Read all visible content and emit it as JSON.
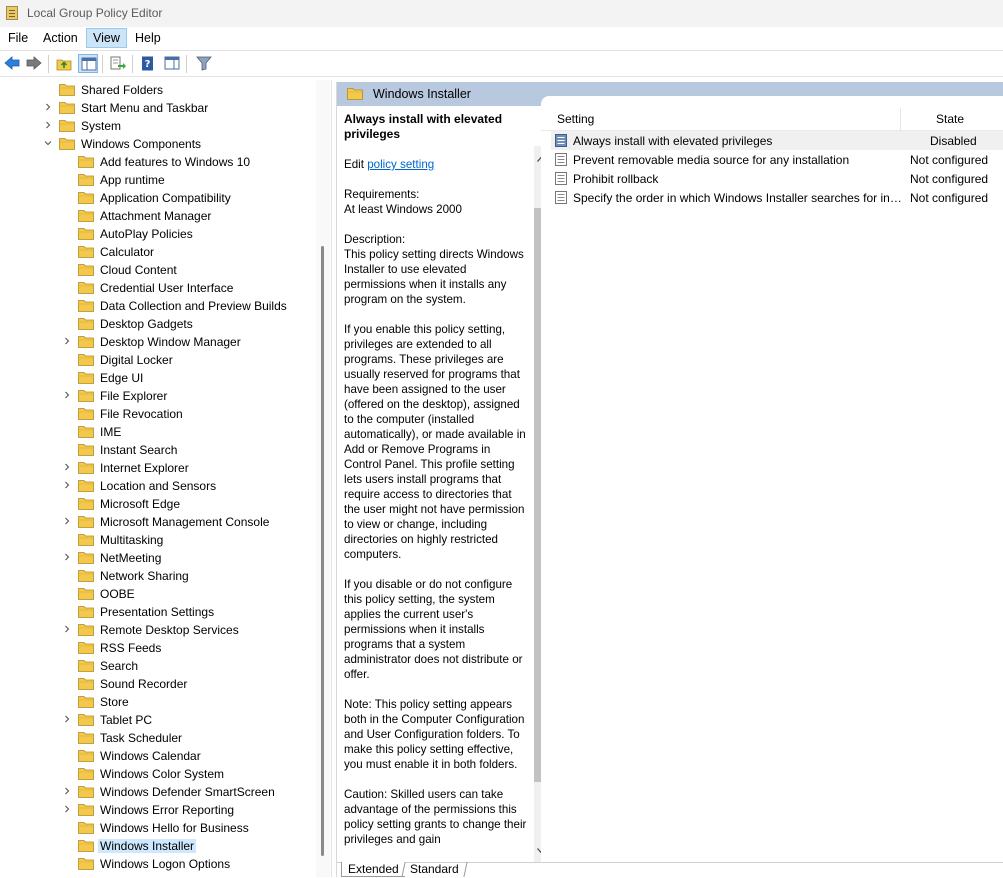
{
  "window": {
    "title": "Local Group Policy Editor"
  },
  "menu": [
    "File",
    "Action",
    "View",
    "Help"
  ],
  "tree": [
    {
      "label": "Shared Folders",
      "level": 1,
      "expand": "none"
    },
    {
      "label": "Start Menu and Taskbar",
      "level": 1,
      "expand": "collapsed"
    },
    {
      "label": "System",
      "level": 1,
      "expand": "collapsed"
    },
    {
      "label": "Windows Components",
      "level": 1,
      "expand": "expanded"
    },
    {
      "label": "Add features to Windows 10",
      "level": 2,
      "expand": "none"
    },
    {
      "label": "App runtime",
      "level": 2,
      "expand": "none"
    },
    {
      "label": "Application Compatibility",
      "level": 2,
      "expand": "none"
    },
    {
      "label": "Attachment Manager",
      "level": 2,
      "expand": "none"
    },
    {
      "label": "AutoPlay Policies",
      "level": 2,
      "expand": "none"
    },
    {
      "label": "Calculator",
      "level": 2,
      "expand": "none"
    },
    {
      "label": "Cloud Content",
      "level": 2,
      "expand": "none"
    },
    {
      "label": "Credential User Interface",
      "level": 2,
      "expand": "none"
    },
    {
      "label": "Data Collection and Preview Builds",
      "level": 2,
      "expand": "none"
    },
    {
      "label": "Desktop Gadgets",
      "level": 2,
      "expand": "none"
    },
    {
      "label": "Desktop Window Manager",
      "level": 2,
      "expand": "collapsed"
    },
    {
      "label": "Digital Locker",
      "level": 2,
      "expand": "none"
    },
    {
      "label": "Edge UI",
      "level": 2,
      "expand": "none"
    },
    {
      "label": "File Explorer",
      "level": 2,
      "expand": "collapsed"
    },
    {
      "label": "File Revocation",
      "level": 2,
      "expand": "none"
    },
    {
      "label": "IME",
      "level": 2,
      "expand": "none"
    },
    {
      "label": "Instant Search",
      "level": 2,
      "expand": "none"
    },
    {
      "label": "Internet Explorer",
      "level": 2,
      "expand": "collapsed"
    },
    {
      "label": "Location and Sensors",
      "level": 2,
      "expand": "collapsed"
    },
    {
      "label": "Microsoft Edge",
      "level": 2,
      "expand": "none"
    },
    {
      "label": "Microsoft Management Console",
      "level": 2,
      "expand": "collapsed"
    },
    {
      "label": "Multitasking",
      "level": 2,
      "expand": "none"
    },
    {
      "label": "NetMeeting",
      "level": 2,
      "expand": "collapsed"
    },
    {
      "label": "Network Sharing",
      "level": 2,
      "expand": "none"
    },
    {
      "label": "OOBE",
      "level": 2,
      "expand": "none"
    },
    {
      "label": "Presentation Settings",
      "level": 2,
      "expand": "none"
    },
    {
      "label": "Remote Desktop Services",
      "level": 2,
      "expand": "collapsed"
    },
    {
      "label": "RSS Feeds",
      "level": 2,
      "expand": "none"
    },
    {
      "label": "Search",
      "level": 2,
      "expand": "none"
    },
    {
      "label": "Sound Recorder",
      "level": 2,
      "expand": "none"
    },
    {
      "label": "Store",
      "level": 2,
      "expand": "none"
    },
    {
      "label": "Tablet PC",
      "level": 2,
      "expand": "collapsed"
    },
    {
      "label": "Task Scheduler",
      "level": 2,
      "expand": "none"
    },
    {
      "label": "Windows Calendar",
      "level": 2,
      "expand": "none"
    },
    {
      "label": "Windows Color System",
      "level": 2,
      "expand": "none"
    },
    {
      "label": "Windows Defender SmartScreen",
      "level": 2,
      "expand": "collapsed"
    },
    {
      "label": "Windows Error Reporting",
      "level": 2,
      "expand": "collapsed"
    },
    {
      "label": "Windows Hello for Business",
      "level": 2,
      "expand": "none"
    },
    {
      "label": "Windows Installer",
      "level": 2,
      "expand": "none",
      "selected": true
    },
    {
      "label": "Windows Logon Options",
      "level": 2,
      "expand": "none"
    }
  ],
  "right": {
    "header_title": "Windows Installer",
    "extended": {
      "policy_title": "Always install with elevated privileges",
      "edit_prefix": "Edit ",
      "edit_link": "policy setting ",
      "requirements_label": "Requirements:",
      "requirements_value": "At least Windows 2000",
      "description_label": "Description:",
      "paragraphs": [
        "This policy setting directs Windows Installer to use elevated permissions when it installs any program on the system.",
        "If you enable this policy setting, privileges are extended to all programs. These privileges are usually reserved for programs that have been assigned to the user (offered on the desktop), assigned to the computer (installed automatically), or made available in Add or Remove Programs in Control Panel. This profile setting lets users install programs that require access to directories that the user might not have permission to view or change, including directories on highly restricted computers.",
        "If you disable or do not configure this policy setting, the system applies the current user's permissions when it installs programs that a system administrator does not distribute or offer.",
        "Note: This policy setting appears both in the Computer Configuration and User Configuration folders. To make this policy setting effective, you must enable it in both folders.",
        "Caution: Skilled users can take advantage of the permissions this policy setting grants to change their privileges and gain"
      ]
    },
    "columns": {
      "setting": "Setting",
      "state": "State"
    },
    "rows": [
      {
        "name": "Always install with elevated privileges",
        "state": "Disabled",
        "selected": true
      },
      {
        "name": "Prevent removable media source for any installation",
        "state": "Not configured"
      },
      {
        "name": "Prohibit rollback",
        "state": "Not configured"
      },
      {
        "name": "Specify the order in which Windows Installer searches for installation files",
        "state": "Not configured"
      }
    ],
    "tabs": [
      "Extended",
      "Standard"
    ]
  },
  "colors": {
    "header_bg": "#b8c8de",
    "selection": "#cde8ff",
    "link": "#0066cc",
    "folder": "#f2c94c"
  }
}
